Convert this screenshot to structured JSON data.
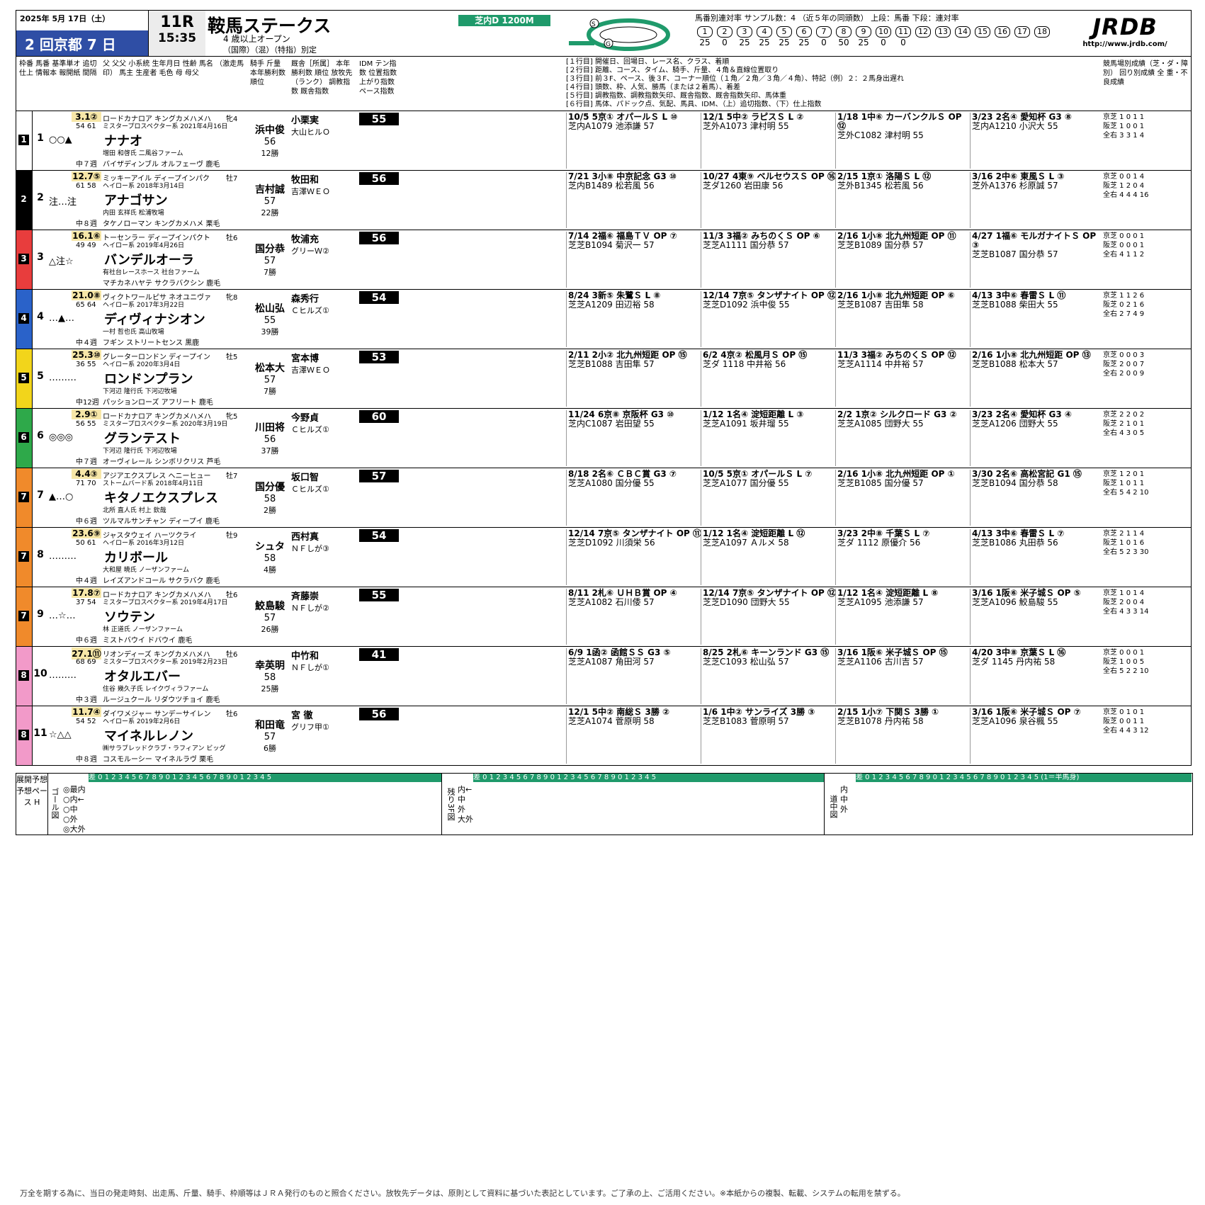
{
  "header": {
    "date": "2025年 5月 17日（土）",
    "meeting": "2 回京都 7 日",
    "race_no": "11R",
    "post_time": "15:35",
    "race_name": "鞍馬ステークス",
    "condition1": "4 歳以上オープン",
    "condition2": "（国際）（混）（特指）別定",
    "course": "芝内D 1200M",
    "stat_label": "馬番別連対率 サンプル数：4 （近５年の同頭数） 上段：馬番 下段：連対率",
    "stat_nums": [
      "1",
      "2",
      "3",
      "4",
      "5",
      "6",
      "7",
      "8",
      "9",
      "10",
      "11",
      "12",
      "13",
      "14",
      "15",
      "16",
      "17",
      "18"
    ],
    "stat_vals": [
      "25",
      "0",
      "25",
      "25",
      "25",
      "25",
      "0",
      "50",
      "25",
      "0",
      "0",
      "",
      "",
      "",
      "",
      "",
      "",
      ""
    ],
    "logo": "JRDB",
    "url": "http://www.jrdb.com/"
  },
  "colhdr": {
    "legend": [
      "[１行目] 開催日、回場日、レース名、クラス、着順",
      "[２行目] 距離、コース、タイム、騎手、斤量、４角＆直線位置取り",
      "[３行目] 前３F、ペース、後３F、コーナー順位（１角／２角／３角／４角）、特記（例）２：２馬身出遅れ",
      "[４行目] 頭数、枠、人気、勝馬（または２着馬）、着差",
      "[５行目] 調教指数、調教指数矢印、厩舎指数、厩舎指数矢印、馬体重",
      "[６行目] 馬体、パドック点、気配、馬具、IDM、（上）追切指数、（下）仕上指数"
    ],
    "left": "枠番 馬番 基準単オ 追切仕上 情報本 報開紙 間隔",
    "mid": "父 父父 小系統 生年月日 性齢 馬名 （激走馬印） 馬主 生産者 毛色 母 母父",
    "jockey": "騎手 斤量 本年勝利数 順位",
    "stable": "厩舎［所属］ 本年勝利数 順位 放牧先（ランク） 調教指数 厩舎指数",
    "idm": "IDM テン指数 位置指数 上がり指数 ペース指数",
    "right": "競馬場別成績（芝・ダ・障別） 回り別成績 全 重・不良成績"
  },
  "rows": [
    {
      "waku": "1",
      "umaban": "1",
      "mark": "○○▲",
      "odds": "3.1②",
      "sub": "54 61",
      "sire": "ロードカナロア キングカメハメハ",
      "sex": "牝4",
      "sub2": "ミスタープロスペクター系 2021年4月16日",
      "name": "ナナオ",
      "breeder": "増田 和啓氏 二風谷ファーム",
      "dam": "バイザディンブル オルフェーヴ 鹿毛",
      "interval": "中７週",
      "jockey": "浜中俊",
      "weight": "56",
      "wins": "12勝",
      "stable": "小栗実",
      "stable2": "大山ヒルＯ",
      "idm": "55",
      "p1": "10/5 5京① オパールＳ L ⑩",
      "p1b": "芝内A1079 池添謙 57",
      "p2": "12/1 5中② ラピスＳ L ②",
      "p2b": "芝外A1073 津村明 55",
      "p3": "1/18 1中⑥ カーバンクルＳ OP ⑫",
      "p3b": "芝外C1082 津村明 55",
      "p4": "3/23 2名④ 愛知杯 G3 ⑧",
      "p4b": "芝内A1210 小沢大 55",
      "g1": "京芝 1 0 1 1",
      "g2": "阪芝 1 0 0 1",
      "g3": "全右 3 3 1 4"
    },
    {
      "waku": "2",
      "umaban": "2",
      "mark": "注…注",
      "odds": "12.7⑤",
      "sub": "61 58",
      "sire": "ミッキーアイル ディープインパク",
      "sex": "牡7",
      "sub2": "ヘイロー系 2018年3月14日",
      "name": "アナゴサン",
      "breeder": "内田 玄祥氏 松浦牧場",
      "dam": "タケノローマン キングカメハメ 栗毛",
      "interval": "中８週",
      "jockey": "吉村誠",
      "weight": "57",
      "wins": "22勝",
      "stable": "牧田和",
      "stable2": "吉澤ＷＥＯ",
      "idm": "56",
      "p1": "7/21 3小⑧ 中京記念 G3 ⑩",
      "p1b": "芝内B1489 松若風 56",
      "p2": "10/27 4東⑨ ベルセウスＳ OP ⑯",
      "p2b": "芝ダ1260 岩田康 56",
      "p3": "2/15 1京① 洛陽Ｓ L ⑫",
      "p3b": "芝外B1345 松若風 56",
      "p4": "3/16 2中⑥ 東風Ｓ L ③",
      "p4b": "芝外A1376 杉原誠 57",
      "g1": "京芝 0 0 1 4",
      "g2": "阪芝 1 2 0 4",
      "g3": "全右 4 4 4 16"
    },
    {
      "waku": "3",
      "umaban": "3",
      "mark": "△注☆",
      "odds": "16.1⑥",
      "sub": "49 49",
      "sire": "トーセンラー ディープインパクト",
      "sex": "牡6",
      "sub2": "ヘイロー系 2019年4月26日",
      "name": "バンデルオーラ",
      "breeder": "有社台レースホース 社台ファーム",
      "dam": "マチカネハヤテ サクラバクシン 鹿毛",
      "interval": "",
      "jockey": "国分恭",
      "weight": "57",
      "wins": "7勝",
      "stable": "牧浦充",
      "stable2": "グリーＷ②",
      "idm": "56",
      "p1": "7/14 2福⑥ 福島ＴＶ OP ⑦",
      "p1b": "芝芝B1094 菊沢一 57",
      "p2": "11/3 3福② みちのくＳ OP ⑥",
      "p2b": "芝芝A1111 国分恭 57",
      "p3": "2/16 1小⑧ 北九州短距 OP ⑪",
      "p3b": "芝芝B1089 国分恭 57",
      "p4": "4/27 1福⑥ モルガナイトＳ OP ③",
      "p4b": "芝芝B1087 国分恭 57",
      "g1": "京芝 0 0 0 1",
      "g2": "阪芝 0 0 0 1",
      "g3": "全右 4 1 1 2"
    },
    {
      "waku": "4",
      "umaban": "4",
      "mark": "…▲…",
      "odds": "21.0⑧",
      "sub": "65 64",
      "sire": "ヴィクトワールピサ ネオユニヴァ",
      "sex": "牝8",
      "sub2": "ヘイロー系 2017年3月22日",
      "name": "ディヴィナシオン",
      "breeder": "一村 哲也氏 高山牧場",
      "dam": "フギン ストリートセンス 黒鹿",
      "interval": "中４週",
      "jockey": "松山弘",
      "weight": "55",
      "wins": "39勝",
      "stable": "森秀行",
      "stable2": "Ｃヒルズ①",
      "idm": "54",
      "p1": "8/24 3新⑤ 朱鷺Ｓ L ⑧",
      "p1b": "芝芝A1209 田辺裕 58",
      "p2": "12/14 7京⑤ タンザナイト OP ⑫",
      "p2b": "芝芝D1092 浜中俊 55",
      "p3": "2/16 1小⑧ 北九州短距 OP ⑥",
      "p3b": "芝芝B1087 吉田隼 58",
      "p4": "4/13 3中⑥ 春雷Ｓ L ⑪",
      "p4b": "芝芝B1088 柴田大 55",
      "g1": "京芝 1 1 2 6",
      "g2": "阪芝 0 2 1 6",
      "g3": "全右 2 7 4 9"
    },
    {
      "waku": "5",
      "umaban": "5",
      "mark": "………",
      "odds": "25.3⑩",
      "sub": "36 55",
      "sire": "グレーターロンドン ディープイン",
      "sex": "牡5",
      "sub2": "ヘイロー系 2020年3月4日",
      "name": "ロンドンプラン",
      "breeder": "下河辺 隆行氏 下河辺牧場",
      "dam": "パッションローズ アフリート 鹿毛",
      "interval": "中12週",
      "jockey": "松本大",
      "weight": "57",
      "wins": "7勝",
      "stable": "宮本博",
      "stable2": "吉澤ＷＥＯ",
      "idm": "53",
      "p1": "2/11 2小② 北九州短距 OP ⑮",
      "p1b": "芝芝B1088 吉田隼 57",
      "p2": "6/2 4京② 松風月Ｓ OP ⑮",
      "p2b": "芝ダ 1118 中井裕 56",
      "p3": "11/3 3福② みちのくＳ OP ⑫",
      "p3b": "芝芝A1114 中井裕 57",
      "p4": "2/16 1小⑧ 北九州短距 OP ⑬",
      "p4b": "芝芝B1088 松本大 57",
      "g1": "京芝 0 0 0 3",
      "g2": "阪芝 2 0 0 7",
      "g3": "全右 2 0 0 9"
    },
    {
      "waku": "6",
      "umaban": "6",
      "mark": "◎◎◎",
      "odds": "2.9①",
      "sub": "56 55",
      "sire": "ロードカナロア キングカメハメハ",
      "sex": "牝5",
      "sub2": "ミスタープロスペクター系 2020年3月19日",
      "name": "グランテスト",
      "breeder": "下河辺 隆行氏 下河辺牧場",
      "dam": "オーヴィレール シンボリクリス 芦毛",
      "interval": "中７週",
      "jockey": "川田将",
      "weight": "56",
      "wins": "37勝",
      "stable": "今野貞",
      "stable2": "Ｃヒルズ①",
      "idm": "60",
      "p1": "11/24 6京⑧ 京阪杯 G3 ⑩",
      "p1b": "芝内C1087 岩田望 55",
      "p2": "1/12 1名④ 淀短距離 L ③",
      "p2b": "芝芝A1091 坂井瑠 55",
      "p3": "2/2 1京② シルクロード G3 ②",
      "p3b": "芝芝A1085 団野大 55",
      "p4": "3/23 2名④ 愛知杯 G3 ④",
      "p4b": "芝芝A1206 団野大 55",
      "g1": "京芝 2 2 0 2",
      "g2": "阪芝 2 1 0 1",
      "g3": "全右 4 3 0 5"
    },
    {
      "waku": "7",
      "umaban": "7",
      "mark": "▲…○",
      "odds": "4.4③",
      "sub": "71 70",
      "sire": "アジアエクスプレス ヘニーヒュー",
      "sex": "牡7",
      "sub2": "ストームバード系 2018年4月11日",
      "name": "キタノエクスプレス",
      "breeder": "北所 直人氏 村上 欽哉",
      "dam": "ツルマルサンチャン ディープイ 鹿毛",
      "interval": "中６週",
      "jockey": "国分優",
      "weight": "58",
      "wins": "2勝",
      "stable": "坂口智",
      "stable2": "Ｃヒルズ①",
      "idm": "57",
      "p1": "8/18 2名⑥ ＣＢＣ賞 G3 ⑦",
      "p1b": "芝芝A1080 国分優 55",
      "p2": "10/5 5京① オパールＳ L ⑦",
      "p2b": "芝芝A1077 国分優 55",
      "p3": "2/16 1小⑧ 北九州短距 OP ①",
      "p3b": "芝芝B1085 国分優 57",
      "p4": "3/30 2名⑥ 高松宮記 G1 ⑮",
      "p4b": "芝芝B1094 国分恭 58",
      "g1": "京芝 1 2 0 1",
      "g2": "阪芝 1 0 1 1",
      "g3": "全右 5 4 2 10"
    },
    {
      "waku": "7",
      "umaban": "8",
      "mark": "………",
      "odds": "23.6⑨",
      "sub": "50 61",
      "sire": "ジャスタウェイ ハーツクライ",
      "sex": "牡9",
      "sub2": "ヘイロー系 2016年3月12日",
      "name": "カリボール",
      "breeder": "大和屋 暁氏 ノーザンファーム",
      "dam": "レイズアンドコール サクラバク 鹿毛",
      "interval": "中４週",
      "jockey": "シュタ",
      "weight": "58",
      "wins": "4勝",
      "stable": "西村真",
      "stable2": "ＮＦしが③",
      "idm": "54",
      "p1": "12/14 7京⑤ タンザナイト OP ⑪",
      "p1b": "芝芝D1092 川須栄 56",
      "p2": "1/12 1名④ 淀短距離 L ⑫",
      "p2b": "芝芝A1097 Ａルメ 58",
      "p3": "3/23 2中⑧ 千葉Ｓ L ⑦",
      "p3b": "芝ダ 1112 原優介 56",
      "p4": "4/13 3中⑥ 春雷Ｓ L ⑦",
      "p4b": "芝芝B1086 丸田恭 56",
      "g1": "京芝 2 1 1 4",
      "g2": "阪芝 1 0 1 6",
      "g3": "全右 5 2 3 30"
    },
    {
      "waku": "7",
      "umaban": "9",
      "mark": "…☆…",
      "odds": "17.8⑦",
      "sub": "37 54",
      "sire": "ロードカナロア キングカメハメハ",
      "sex": "牡6",
      "sub2": "ミスタープロスペクター系 2019年4月17日",
      "name": "ソウテン",
      "breeder": "林 正道氏 ノーザンファーム",
      "dam": "ミストバウイ ドバウイ 鹿毛",
      "interval": "中６週",
      "jockey": "鮫島駿",
      "weight": "57",
      "wins": "26勝",
      "stable": "斉藤崇",
      "stable2": "ＮＦしが②",
      "idm": "55",
      "p1": "8/11 2札⑥ ＵＨＢ賞 OP ④",
      "p1b": "芝芝A1082 石川倭 57",
      "p2": "12/14 7京⑤ タンザナイト OP ⑫",
      "p2b": "芝芝D1090 団野大 55",
      "p3": "1/12 1名④ 淀短距離 L ⑧",
      "p3b": "芝芝A1095 池添謙 57",
      "p4": "3/16 1阪⑥ 米子城Ｓ OP ⑤",
      "p4b": "芝芝A1096 鮫島駿 55",
      "g1": "京芝 1 0 1 4",
      "g2": "阪芝 2 0 0 4",
      "g3": "全右 4 3 3 14"
    },
    {
      "waku": "8",
      "umaban": "10",
      "mark": "………",
      "odds": "27.1⑪",
      "sub": "68 69",
      "sire": "リオンディーズ キングカメハメハ",
      "sex": "牡6",
      "sub2": "ミスタープロスペクター系 2019年2月23日",
      "name": "オタルエバー",
      "breeder": "住谷 幾久子氏 レイクヴィラファーム",
      "dam": "ルージュクール リダウツチョイ 鹿毛",
      "interval": "中３週",
      "jockey": "幸英明",
      "weight": "58",
      "wins": "25勝",
      "stable": "中竹和",
      "stable2": "ＮＦしが①",
      "idm": "41",
      "p1": "6/9 1函② 函館ＳＳ G3 ⑤",
      "p1b": "芝芝A1087 角田河 57",
      "p2": "8/25 2札⑥ キーンランド G3 ⑮",
      "p2b": "芝芝C1093 松山弘 57",
      "p3": "3/16 1阪⑥ 米子城Ｓ OP ⑮",
      "p3b": "芝芝A1106 古川吉 57",
      "p4": "4/20 3中⑧ 京葉Ｓ L ⑯",
      "p4b": "芝ダ 1145 丹内祐 58",
      "g1": "京芝 0 0 0 1",
      "g2": "阪芝 1 0 0 5",
      "g3": "全右 5 2 2 10"
    },
    {
      "waku": "8",
      "umaban": "11",
      "mark": "☆△△",
      "odds": "11.7④",
      "sub": "54 52",
      "sire": "ダイワメジャー サンデーサイレン",
      "sex": "牡6",
      "sub2": "ヘイロー系 2019年2月6日",
      "name": "マイネルレノン",
      "breeder": "㈱サラブレッドクラブ・ラフィアン ビッグ",
      "dam": "コスモルーシー マイネルラヴ 栗毛",
      "interval": "中８週",
      "jockey": "和田竜",
      "weight": "57",
      "wins": "6勝",
      "stable": "宮 徹",
      "stable2": "グリフ甲①",
      "idm": "56",
      "p1": "12/1 5中② 南総Ｓ 3勝 ②",
      "p1b": "芝芝A1074 菅原明 58",
      "p2": "1/6 1中② サンライズ 3勝 ③",
      "p2b": "芝芝B1083 菅原明 57",
      "p3": "2/15 1小⑦ 下関Ｓ 3勝 ①",
      "p3b": "芝芝B1078 丹内祐 58",
      "p4": "3/16 1阪⑥ 米子城Ｓ OP ⑦",
      "p4b": "芝芝A1096 泉谷楓 55",
      "g1": "京芝 0 1 0 1",
      "g2": "阪芝 0 0 1 1",
      "g3": "全右 4 4 3 12"
    }
  ],
  "pace": {
    "label": "展開予想 予想ペース H",
    "scale": "差 0 1 2 3 4 5 6 7 8 9 0 1 2 3 4 5 6 7 8 9 0 1 2 3 4 5",
    "scale_note": "(1＝半馬身)",
    "goal_title": "ゴール図",
    "goal_lanes": [
      "◎最内",
      "○内←",
      "○中",
      "○外",
      "◎大外"
    ],
    "mid_title": "残り3F図",
    "mid_lanes": [
      "内←",
      "中",
      "外",
      "大外"
    ],
    "end_title": "道中図",
    "end_lanes": [
      "内",
      "中",
      "外"
    ]
  },
  "footer": "万全を期する為に、当日の発走時刻、出走馬、斤量、騎手、枠順等はＪＲＡ発行のものと照合ください。放牧先データは、原則として資料に基づいた表記としています。ご了承の上、ご活用ください。※本紙からの複製、転載、システムの転用を禁ずる。",
  "colors": {
    "w1": "#ffffff",
    "w2": "#000000",
    "w3": "#e83d3d",
    "w4": "#2a62c9",
    "w5": "#f2d51b",
    "w6": "#2ea94a",
    "w7": "#f08a2b",
    "w8": "#f29ac9",
    "accent": "#1f9a6b",
    "meet": "#2f4ea5"
  }
}
